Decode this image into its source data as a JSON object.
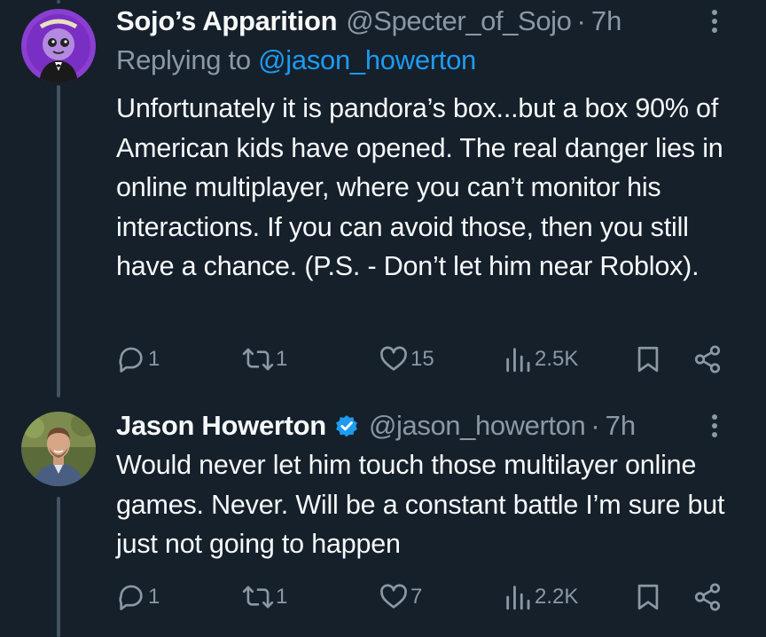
{
  "tweets": [
    {
      "display_name": "Sojo’s Apparition",
      "handle": "@Specter_of_Sojo",
      "separator": "·",
      "time": "7h",
      "reply_prefix": "Replying to",
      "reply_mention": "@jason_howerton",
      "text": "Unfortunately it is pandora’s box...but a box 90% of American kids have opened.   The real danger lies in online multiplayer, where you can’t monitor his interactions.  If you can avoid those, then you still have a chance. (P.S. - Don’t let him near Roblox).",
      "verified": false,
      "actions": {
        "replies": "1",
        "reposts": "1",
        "likes": "15",
        "views": "2.5K"
      }
    },
    {
      "display_name": "Jason Howerton",
      "handle": "@jason_howerton",
      "separator": "·",
      "time": "7h",
      "text": "Would never let him touch those multilayer online games. Never. Will be a constant battle I’m sure but just not going to happen",
      "verified": true,
      "actions": {
        "replies": "1",
        "reposts": "1",
        "likes": "7",
        "views": "2.2K"
      }
    }
  ],
  "colors": {
    "background": "#15202b",
    "text": "#f7f9f9",
    "muted": "#8b98a5",
    "accent": "#1d9bf0",
    "thread_line": "#425364"
  },
  "icons": [
    "reply-icon",
    "repost-icon",
    "like-icon",
    "views-icon",
    "bookmark-icon",
    "share-icon",
    "more-icon",
    "verified-badge-icon"
  ]
}
